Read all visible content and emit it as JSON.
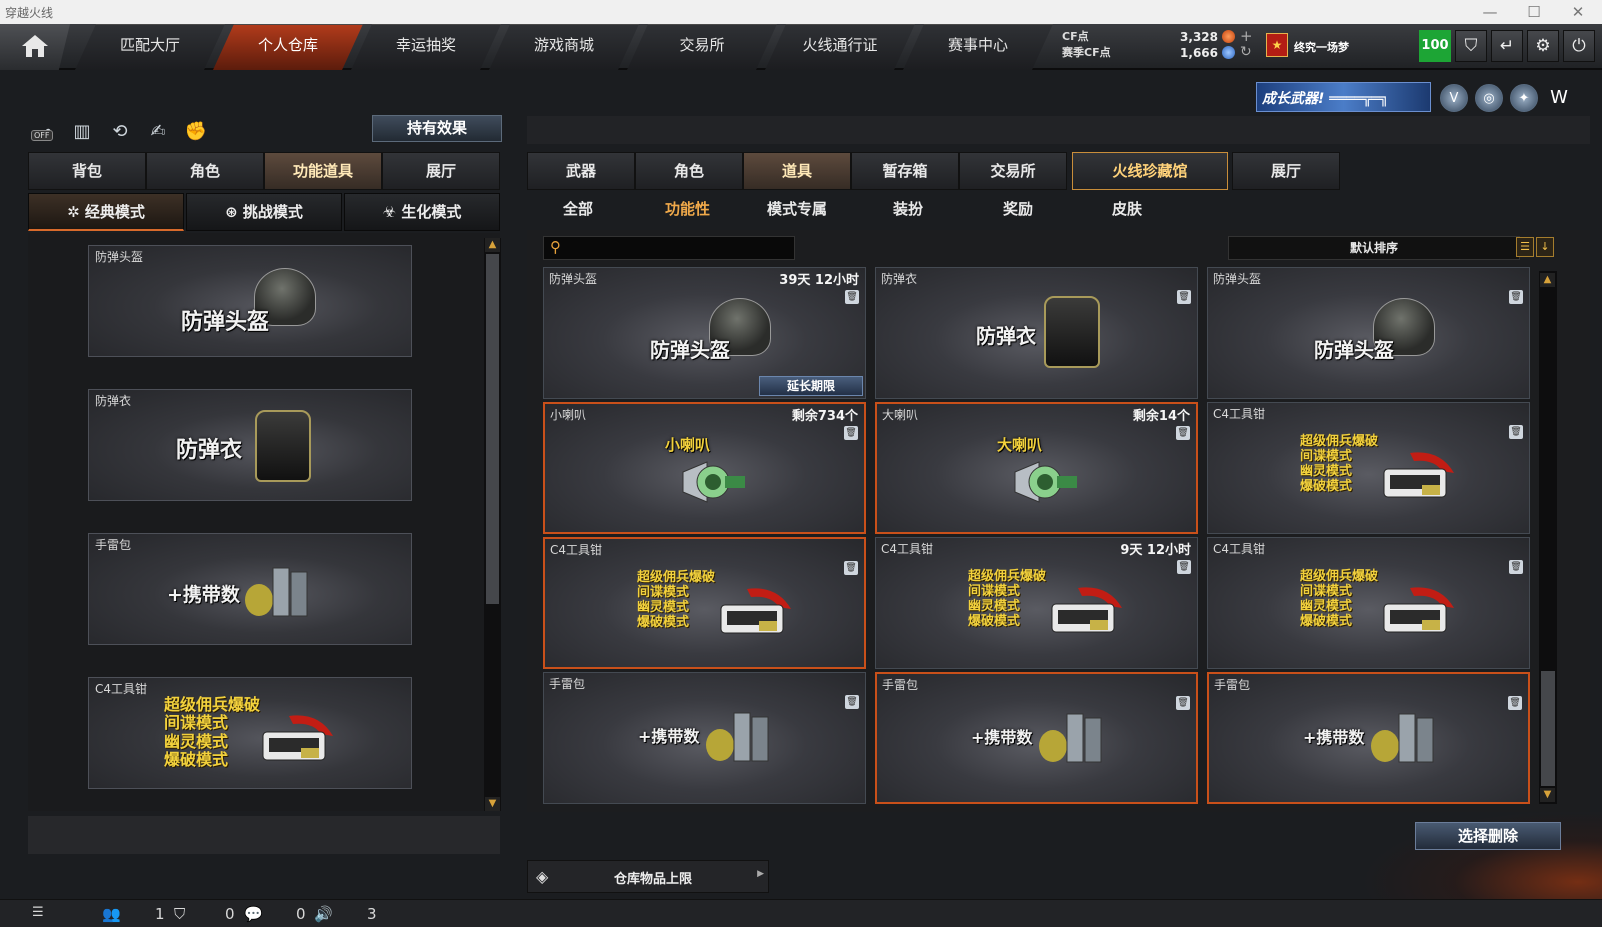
{
  "window": {
    "title": "穿越火线",
    "minimize": "—",
    "maximize": "☐",
    "close": "✕"
  },
  "topnav": {
    "tabs": [
      {
        "label": "匹配大厅"
      },
      {
        "label": "个人仓库"
      },
      {
        "label": "幸运抽奖"
      },
      {
        "label": "游戏商城"
      },
      {
        "label": "交易所"
      },
      {
        "label": "火线通行证"
      },
      {
        "label": "赛事中心"
      }
    ],
    "active": "个人仓库",
    "cf_label": "CF点",
    "season_cf_label": "赛季CF点",
    "cf_value": "3,328",
    "season_cf_value": "1,666",
    "username": "终究一场梦",
    "level": "100"
  },
  "banner": {
    "growth_label": "成长武器!"
  },
  "left": {
    "effects_button": "持有效果",
    "off_label": "OFF",
    "tabs": [
      "背包",
      "角色",
      "功能道具",
      "展厅"
    ],
    "active_tab": "功能道具",
    "modes": [
      "经典模式",
      "挑战模式",
      "生化模式"
    ],
    "active_mode": "经典模式",
    "items": [
      {
        "category": "防弹头盔",
        "name": "防弹头盔"
      },
      {
        "category": "防弹衣",
        "name": "防弹衣"
      },
      {
        "category": "手雷包",
        "name": "+携带数"
      },
      {
        "category": "C4工具钳",
        "lines": [
          "超级佣兵爆破",
          "间谍模式",
          "幽灵模式",
          "爆破模式"
        ]
      }
    ]
  },
  "right": {
    "tabs": [
      "武器",
      "角色",
      "道具",
      "暂存箱",
      "交易所",
      "火线珍藏馆",
      "展厅"
    ],
    "active_tab": "道具",
    "highlight_tab": "火线珍藏馆",
    "subtabs": [
      "全部",
      "功能性",
      "模式专属",
      "装扮",
      "奖励",
      "皮肤"
    ],
    "active_subtab": "功能性",
    "search_placeholder": "",
    "sort_label": "默认排序",
    "sort_list_icon": "☰",
    "sort_dir_icon": "↓",
    "cards": [
      {
        "category": "防弹头盔",
        "time": "39天 12小时",
        "name": "防弹头盔",
        "extend": "延长期限"
      },
      {
        "category": "防弹衣",
        "time": "",
        "name": "防弹衣"
      },
      {
        "category": "防弹头盔",
        "time": "",
        "name": "防弹头盔"
      },
      {
        "category": "小喇叭",
        "time": "剩余734个",
        "name": "小喇叭"
      },
      {
        "category": "大喇叭",
        "time": "剩余14个",
        "name": "大喇叭"
      },
      {
        "category": "C4工具钳",
        "time": "",
        "lines": [
          "超级佣兵爆破",
          "间谍模式",
          "幽灵模式",
          "爆破模式"
        ]
      },
      {
        "category": "C4工具钳",
        "time": "",
        "lines": [
          "超级佣兵爆破",
          "间谍模式",
          "幽灵模式",
          "爆破模式"
        ]
      },
      {
        "category": "C4工具钳",
        "time": "9天 12小时",
        "lines": [
          "超级佣兵爆破",
          "间谍模式",
          "幽灵模式",
          "爆破模式"
        ]
      },
      {
        "category": "C4工具钳",
        "time": "",
        "lines": [
          "超级佣兵爆破",
          "间谍模式",
          "幽灵模式",
          "爆破模式"
        ]
      },
      {
        "category": "手雷包",
        "time": "",
        "name": "+携带数"
      },
      {
        "category": "手雷包",
        "time": "",
        "name": "+携带数"
      },
      {
        "category": "手雷包",
        "time": "",
        "name": "+携带数"
      }
    ],
    "delete_button": "选择删除",
    "capacity_label": "仓库物品上限"
  },
  "statusbar": {
    "v1": "1",
    "v2": "0",
    "v3": "0",
    "v4": "3"
  },
  "colors": {
    "accent": "#c9501a",
    "gold": "#f2d13c",
    "level_green": "#1da535"
  }
}
